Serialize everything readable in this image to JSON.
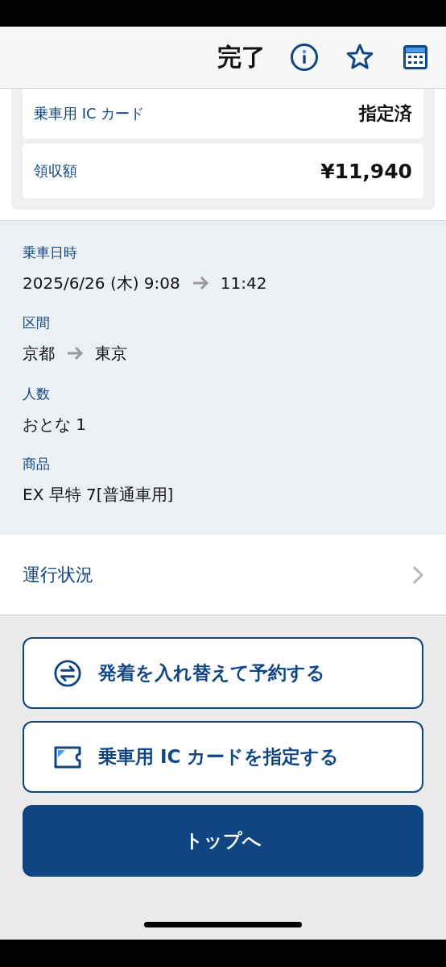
{
  "header": {
    "title": "完了"
  },
  "summary": [
    {
      "label": "乗車用 IC カード",
      "value": "指定済",
      "kind": "text"
    },
    {
      "label": "領収額",
      "value": "¥11,940",
      "kind": "amount"
    }
  ],
  "details": [
    {
      "label": "乗車日時",
      "kind": "range",
      "from": "2025/6/26 (木) 9:08",
      "to": "11:42"
    },
    {
      "label": "区間",
      "kind": "range",
      "from": "京都",
      "to": "東京"
    },
    {
      "label": "人数",
      "kind": "plain",
      "value": "おとな 1"
    },
    {
      "label": "商品",
      "kind": "plain",
      "value": "EX 早特 7[普通車用]"
    }
  ],
  "status_link": {
    "label": "運行状況"
  },
  "buttons": [
    {
      "label": "発着を入れ替えて予約する",
      "kind": "swap"
    },
    {
      "label": "乗車用 IC カードを指定する",
      "kind": "card"
    },
    {
      "label": "トップへ",
      "kind": "primary"
    }
  ]
}
